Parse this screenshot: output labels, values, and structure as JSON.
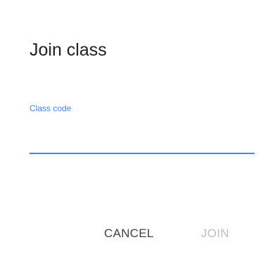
{
  "dialog": {
    "title": "Join class",
    "field": {
      "label": "Class code",
      "value": "",
      "placeholder": ""
    },
    "actions": {
      "cancel_label": "CANCEL",
      "join_label": "JOIN",
      "join_enabled": false
    }
  },
  "colors": {
    "accent": "#4285f4",
    "title_text": "#212121",
    "cancel_text": "#424242",
    "disabled_text": "#bdbdbd",
    "background": "#ffffff"
  }
}
